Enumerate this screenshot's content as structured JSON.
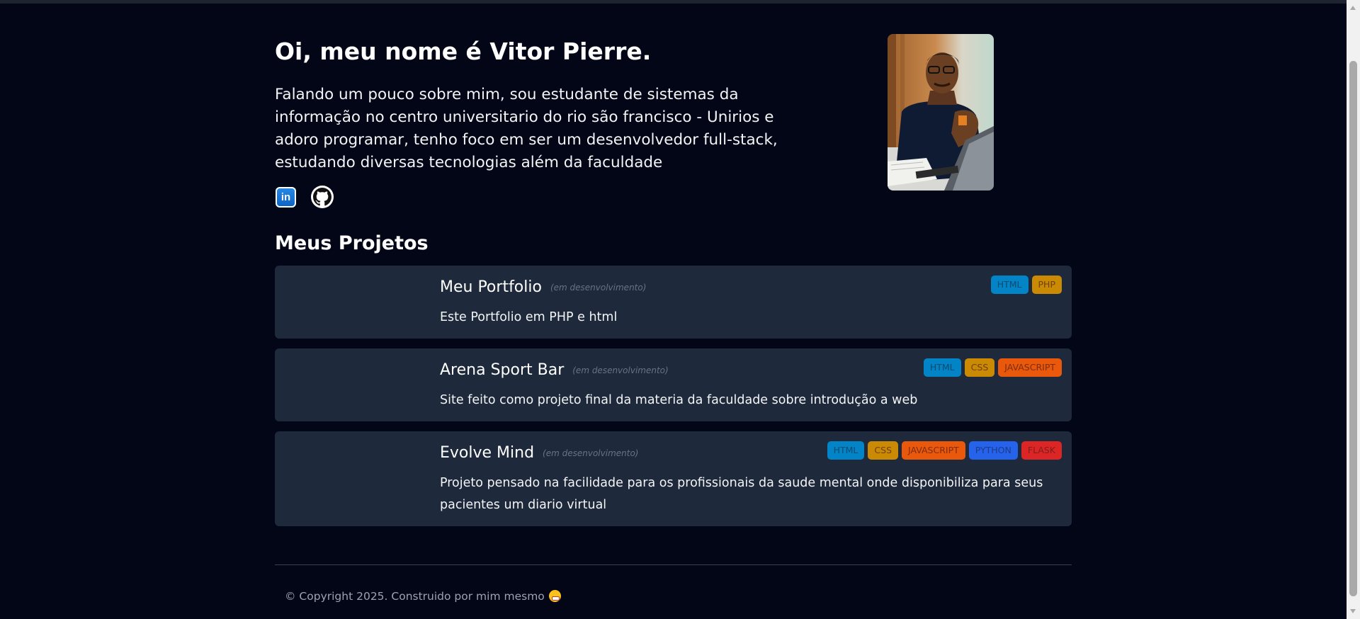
{
  "hero": {
    "title": "Oi, meu nome é Vitor Pierre.",
    "bio": "Falando um pouco sobre mim, sou estudante de sistemas da informação no centro universitario do rio são francisco - Unirios e adoro programar, tenho foco em ser um desenvolvedor full-stack, estudando diversas tecnologias além da faculdade",
    "linkedin_label": "in"
  },
  "projects_section": {
    "title": "Meus Projetos"
  },
  "projects": [
    {
      "name": "Meu Portfolio",
      "status": "(em desenvolvimento)",
      "description": "Este Portfolio em PHP e html",
      "tags": [
        {
          "label": "HTML",
          "bg": "#0284c7",
          "fg": "#0c4a6e"
        },
        {
          "label": "PHP",
          "bg": "#ca8a04",
          "fg": "#713f12"
        }
      ]
    },
    {
      "name": "Arena Sport Bar",
      "status": "(em desenvolvimento)",
      "description": "Site feito como projeto final da materia da faculdade sobre introdução a web",
      "tags": [
        {
          "label": "HTML",
          "bg": "#0284c7",
          "fg": "#0c4a6e"
        },
        {
          "label": "CSS",
          "bg": "#ca8a04",
          "fg": "#713f12"
        },
        {
          "label": "JAVASCRIPT",
          "bg": "#ea580c",
          "fg": "#7c2d12"
        }
      ]
    },
    {
      "name": "Evolve Mind",
      "status": "(em desenvolvimento)",
      "description": "Projeto pensado na facilidade para os profissionais da saude mental onde disponibiliza para seus pacientes um diario virtual",
      "tags": [
        {
          "label": "HTML",
          "bg": "#0284c7",
          "fg": "#0c4a6e"
        },
        {
          "label": "CSS",
          "bg": "#ca8a04",
          "fg": "#713f12"
        },
        {
          "label": "JAVASCRIPT",
          "bg": "#ea580c",
          "fg": "#7c2d12"
        },
        {
          "label": "PYTHON",
          "bg": "#2563eb",
          "fg": "#1e3a8a"
        },
        {
          "label": "FLASK",
          "bg": "#dc2626",
          "fg": "#7f1d1d"
        }
      ]
    }
  ],
  "footer": {
    "text": "© Copyright 2025. Construido por mim mesmo"
  }
}
